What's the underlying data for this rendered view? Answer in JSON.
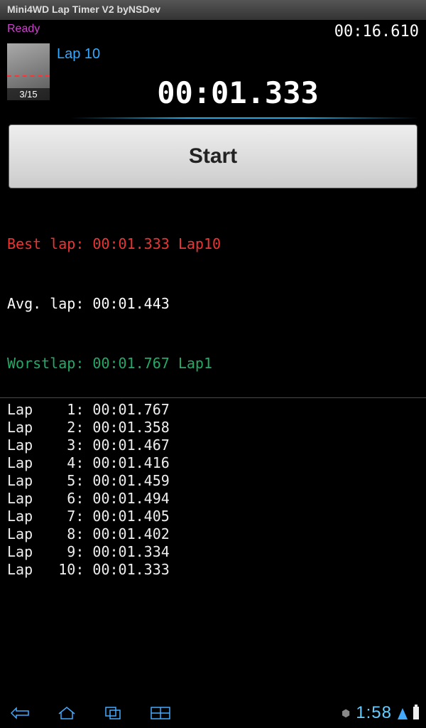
{
  "title_bar": "Mini4WD Lap Timer V2 byNSDev",
  "status_label": "Ready",
  "total_time": "00:16.610",
  "camera_count": "3/15",
  "lap_label": "Lap 10",
  "current_lap_time": "00:01.333",
  "start_button": "Start",
  "stats": {
    "best": "Best lap: 00:01.333 Lap10",
    "avg": "Avg. lap: 00:01.443",
    "worst": "Worstlap: 00:01.767 Lap1"
  },
  "laps": [
    "Lap    1: 00:01.767",
    "Lap    2: 00:01.358",
    "Lap    3: 00:01.467",
    "Lap    4: 00:01.416",
    "Lap    5: 00:01.459",
    "Lap    6: 00:01.494",
    "Lap    7: 00:01.405",
    "Lap    8: 00:01.402",
    "Lap    9: 00:01.334",
    "Lap   10: 00:01.333"
  ],
  "nav": {
    "clock": "1:58"
  }
}
